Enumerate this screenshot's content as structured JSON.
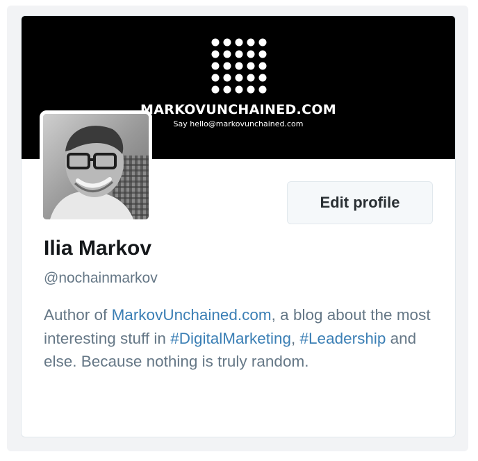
{
  "banner": {
    "title": "MARKOVUNCHAINED.COM",
    "subtitle": "Say hello@markovunchained.com"
  },
  "profile": {
    "name": "Ilia Markov",
    "handle": "@nochainmarkov",
    "edit_label": "Edit profile"
  },
  "bio": {
    "part1": "Author of ",
    "link_site": "MarkovUnchained.com",
    "part2": ", a blog about the most interesting stuff in ",
    "hashtag1": "#DigitalMarketing",
    "part3": ", ",
    "hashtag2": "#Leadership",
    "part4": " and else. Because nothing is truly random."
  },
  "colors": {
    "link": "#3b7fb5",
    "text_secondary": "#657786",
    "banner_bg": "#000000"
  }
}
